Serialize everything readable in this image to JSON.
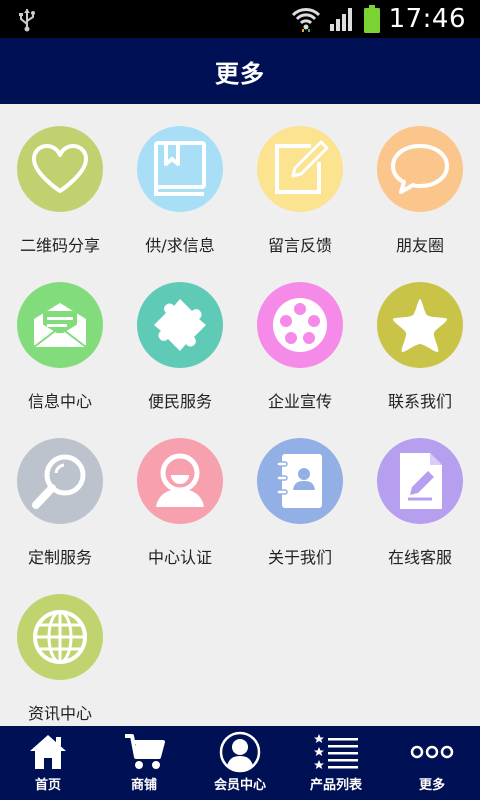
{
  "status_bar": {
    "time": "17:46",
    "icons": [
      "usb-icon",
      "wifi-icon",
      "signal-icon",
      "battery-icon"
    ]
  },
  "header": {
    "title": "更多"
  },
  "grid": {
    "items": [
      {
        "label": "二维码分享",
        "icon": "heart-icon",
        "color": "#c2d170"
      },
      {
        "label": "供/求信息",
        "icon": "book-icon",
        "color": "#a9def7"
      },
      {
        "label": "留言反馈",
        "icon": "edit-note-icon",
        "color": "#fbe38f"
      },
      {
        "label": "朋友圈",
        "icon": "speech-bubble-icon",
        "color": "#fbc68c"
      },
      {
        "label": "信息中心",
        "icon": "mail-icon",
        "color": "#82dc7c"
      },
      {
        "label": "便民服务",
        "icon": "puzzle-icon",
        "color": "#5fcbb7"
      },
      {
        "label": "企业宣传",
        "icon": "film-reel-icon",
        "color": "#f58ae9"
      },
      {
        "label": "联系我们",
        "icon": "star-icon",
        "color": "#c9c447"
      },
      {
        "label": "定制服务",
        "icon": "magnifier-icon",
        "color": "#bcc3cc"
      },
      {
        "label": "中心认证",
        "icon": "user-icon",
        "color": "#f7a0ae"
      },
      {
        "label": "关于我们",
        "icon": "contact-book-icon",
        "color": "#92b0e6"
      },
      {
        "label": "在线客服",
        "icon": "document-icon",
        "color": "#b79ff0"
      },
      {
        "label": "资讯中心",
        "icon": "globe-icon",
        "color": "#bfd36e"
      }
    ]
  },
  "bottom_nav": {
    "background": "#001055",
    "items": [
      {
        "label": "首页",
        "icon": "home-icon"
      },
      {
        "label": "商铺",
        "icon": "cart-icon"
      },
      {
        "label": "会员中心",
        "icon": "member-icon"
      },
      {
        "label": "产品列表",
        "icon": "list-icon"
      },
      {
        "label": "更多",
        "icon": "more-icon"
      }
    ]
  }
}
